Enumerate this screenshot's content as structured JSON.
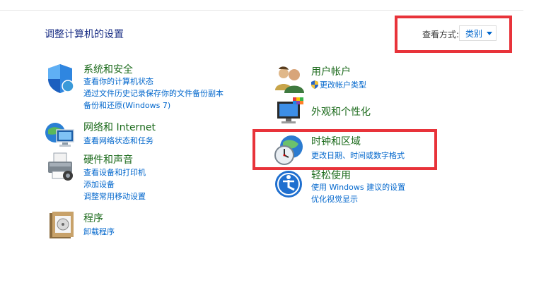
{
  "page": {
    "title": "调整计算机的设置"
  },
  "view": {
    "label": "查看方式:",
    "value": "类别"
  },
  "categories_left": [
    {
      "title": "系统和安全",
      "icon": "shield-icon",
      "links": [
        "查看你的计算机状态",
        "通过文件历史记录保存你的文件备份副本",
        "备份和还原(Windows 7)"
      ]
    },
    {
      "title": "网络和 Internet",
      "icon": "network-icon",
      "links": [
        "查看网络状态和任务"
      ]
    },
    {
      "title": "硬件和声音",
      "icon": "printer-icon",
      "links": [
        "查看设备和打印机",
        "添加设备",
        "调整常用移动设置"
      ]
    },
    {
      "title": "程序",
      "icon": "programs-icon",
      "links": [
        "卸载程序"
      ]
    }
  ],
  "categories_right": [
    {
      "title": "用户帐户",
      "icon": "users-icon",
      "links": [
        "更改帐户类型"
      ]
    },
    {
      "title": "外观和个性化",
      "icon": "monitor-icon",
      "links": []
    },
    {
      "title": "时钟和区域",
      "icon": "clock-globe-icon",
      "links": [
        "更改日期、时间或数字格式"
      ]
    },
    {
      "title": "轻松使用",
      "icon": "accessibility-icon",
      "links": [
        "使用 Windows 建议的设置",
        "优化视觉显示"
      ]
    }
  ],
  "highlight_color": "#e8333a"
}
